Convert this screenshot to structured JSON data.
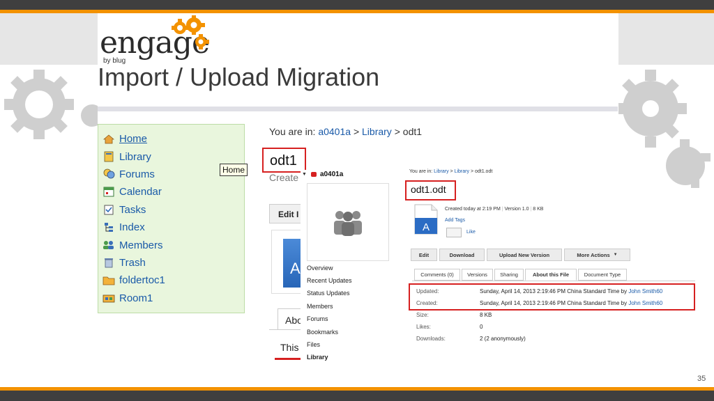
{
  "colors": {
    "accent": "#f39200",
    "dark_bar": "#3f3f3f",
    "link": "#1a5aa8",
    "highlight": "#d62020",
    "nav_bg": "#e9f6dd"
  },
  "logo": {
    "wordmark": "engage",
    "tagline": "by blug"
  },
  "slide": {
    "title": "Import / Upload Migration",
    "page_number": "35"
  },
  "nav": {
    "items": [
      {
        "label": "Home",
        "icon": "home-icon"
      },
      {
        "label": "Library",
        "icon": "library-icon"
      },
      {
        "label": "Forums",
        "icon": "forums-icon"
      },
      {
        "label": "Calendar",
        "icon": "calendar-icon"
      },
      {
        "label": "Tasks",
        "icon": "tasks-icon"
      },
      {
        "label": "Index",
        "icon": "index-icon"
      },
      {
        "label": "Members",
        "icon": "members-icon"
      },
      {
        "label": "Trash",
        "icon": "trash-icon"
      },
      {
        "label": "foldertoc1",
        "icon": "folder-icon"
      },
      {
        "label": "Room1",
        "icon": "room-icon"
      }
    ],
    "tooltip": "Home"
  },
  "main": {
    "breadcrumb_prefix": "You are in:",
    "breadcrumb": [
      "a0401a",
      "Library",
      "odt1"
    ],
    "sep": ">",
    "doc_title": "odt1",
    "create_text": "Create",
    "edit_label": "Edit I",
    "file_letter": "A",
    "about_tab_partial": "Abo",
    "this_partial": "This"
  },
  "community_menu": {
    "name": "a0401a",
    "items": [
      "Overview",
      "Recent Updates",
      "Status Updates",
      "Members",
      "Forums",
      "Bookmarks",
      "Files",
      "Library"
    ]
  },
  "file": {
    "breadcrumb_prefix": "You are in:",
    "breadcrumb": [
      "Library",
      "Library",
      "odt1.odt"
    ],
    "sep": ">",
    "name": "odt1.odt",
    "created_today": "Created today at 2:19 PM",
    "version": "Version 1.0",
    "size_short": "8 KB",
    "add_tags": "Add Tags",
    "like": "Like",
    "icon_letter": "A",
    "buttons": {
      "edit": "Edit",
      "download": "Download",
      "upload": "Upload New Version",
      "more": "More Actions"
    },
    "tabs": [
      "Comments (0)",
      "Versions",
      "Sharing",
      "About this File",
      "Document Type"
    ],
    "props": {
      "updated_label": "Updated:",
      "updated_value": "Sunday, April 14, 2013 2:19:46 PM China Standard Time by",
      "updated_by": "John Smith60",
      "created_label": "Created:",
      "created_value": "Sunday, April 14, 2013 2:19:46 PM China Standard Time by",
      "created_by": "John Smith60",
      "size_label": "Size:",
      "size_value": "8 KB",
      "likes_label": "Likes:",
      "likes_value": "0",
      "downloads_label": "Downloads:",
      "downloads_value": "2 (2 anonymously)"
    }
  }
}
